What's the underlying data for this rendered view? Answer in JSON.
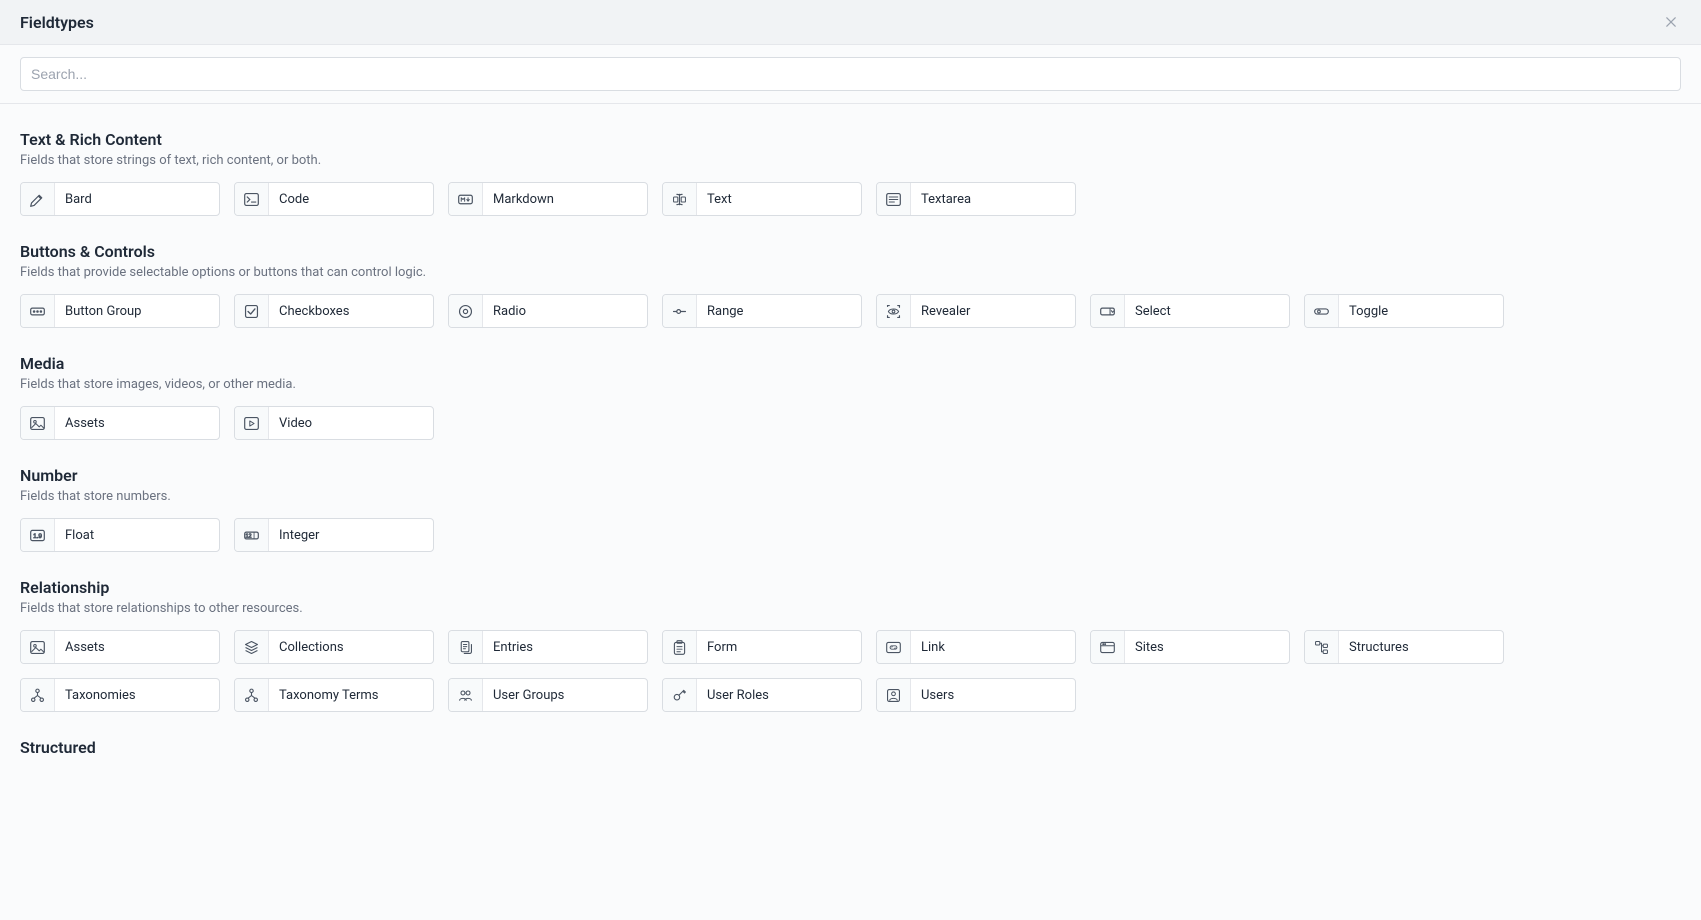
{
  "header": {
    "title": "Fieldtypes"
  },
  "search": {
    "placeholder": "Search...",
    "value": ""
  },
  "groups": [
    {
      "title": "Text & Rich Content",
      "desc": "Fields that store strings of text, rich content, or both.",
      "items": [
        {
          "label": "Bard",
          "icon": "pen"
        },
        {
          "label": "Code",
          "icon": "terminal"
        },
        {
          "label": "Markdown",
          "icon": "markdown"
        },
        {
          "label": "Text",
          "icon": "text-cursor"
        },
        {
          "label": "Textarea",
          "icon": "textarea"
        }
      ]
    },
    {
      "title": "Buttons & Controls",
      "desc": "Fields that provide selectable options or buttons that can control logic.",
      "items": [
        {
          "label": "Button Group",
          "icon": "button-group"
        },
        {
          "label": "Checkboxes",
          "icon": "checkbox"
        },
        {
          "label": "Radio",
          "icon": "radio"
        },
        {
          "label": "Range",
          "icon": "range"
        },
        {
          "label": "Revealer",
          "icon": "eye-scan"
        },
        {
          "label": "Select",
          "icon": "select"
        },
        {
          "label": "Toggle",
          "icon": "toggle"
        }
      ]
    },
    {
      "title": "Media",
      "desc": "Fields that store images, videos, or other media.",
      "items": [
        {
          "label": "Assets",
          "icon": "image"
        },
        {
          "label": "Video",
          "icon": "video"
        }
      ]
    },
    {
      "title": "Number",
      "desc": "Fields that store numbers.",
      "items": [
        {
          "label": "Float",
          "icon": "number-float"
        },
        {
          "label": "Integer",
          "icon": "number-int"
        }
      ]
    },
    {
      "title": "Relationship",
      "desc": "Fields that store relationships to other resources.",
      "items": [
        {
          "label": "Assets",
          "icon": "image"
        },
        {
          "label": "Collections",
          "icon": "stack"
        },
        {
          "label": "Entries",
          "icon": "pages"
        },
        {
          "label": "Form",
          "icon": "clipboard"
        },
        {
          "label": "Link",
          "icon": "link"
        },
        {
          "label": "Sites",
          "icon": "browser"
        },
        {
          "label": "Structures",
          "icon": "tree"
        },
        {
          "label": "Taxonomies",
          "icon": "taxonomy"
        },
        {
          "label": "Taxonomy Terms",
          "icon": "taxonomy"
        },
        {
          "label": "User Groups",
          "icon": "users"
        },
        {
          "label": "User Roles",
          "icon": "key"
        },
        {
          "label": "Users",
          "icon": "user"
        }
      ]
    },
    {
      "title": "Structured",
      "desc": "",
      "items": []
    }
  ]
}
